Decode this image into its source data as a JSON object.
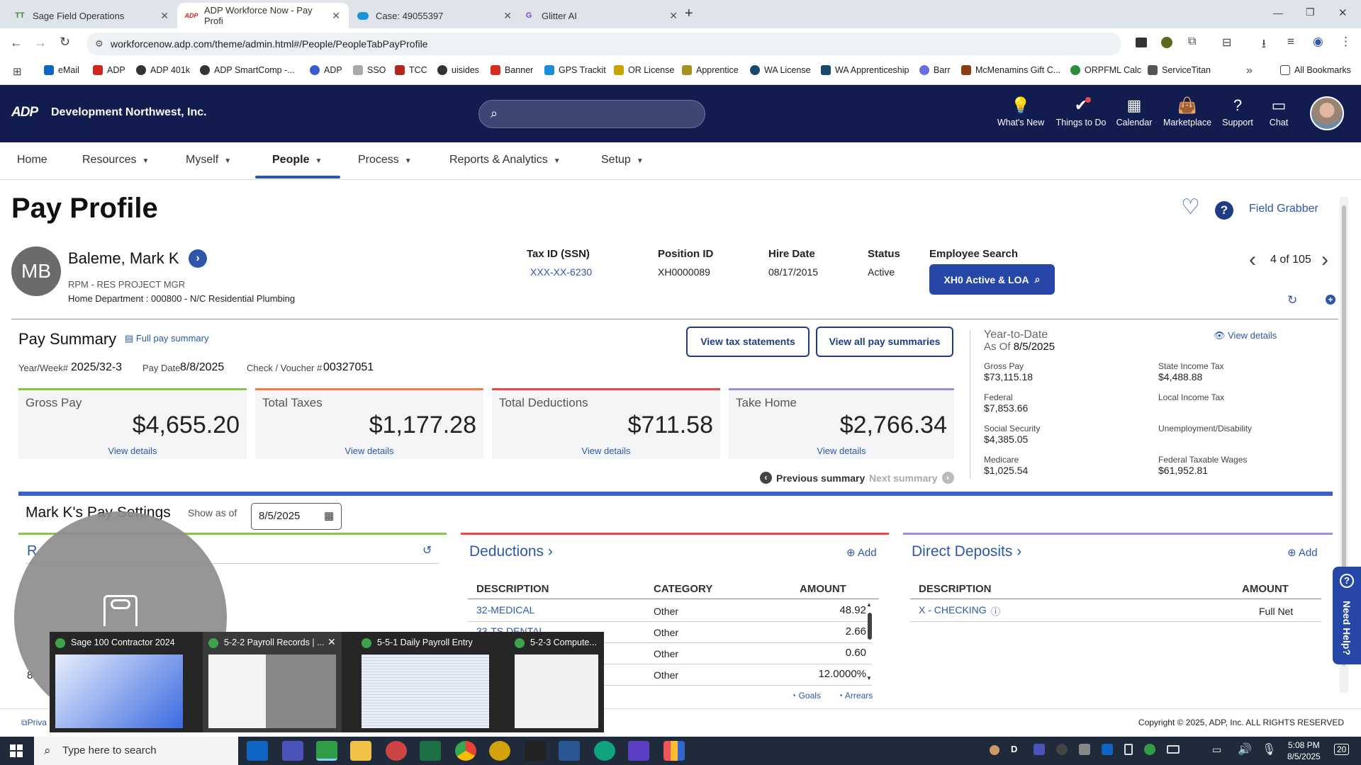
{
  "browser": {
    "tabs": [
      {
        "label": "Sage Field Operations",
        "favicon": "TT"
      },
      {
        "label": "ADP Workforce Now - Pay Profi",
        "favicon": "ADP"
      },
      {
        "label": "Case: 49055397",
        "favicon": ""
      },
      {
        "label": "Glitter AI",
        "favicon": "G"
      }
    ],
    "url": "workforcenow.adp.com/theme/admin.html#/People/PeopleTabPayProfile",
    "bookmarks": [
      "eMail",
      "ADP",
      "ADP 401k",
      "ADP SmartComp -...",
      "ADP",
      "SSO",
      "TCC",
      "uisides",
      "Banner",
      "GPS Trackit",
      "OR License",
      "Apprentice",
      "WA License",
      "WA Apprenticeship",
      "Barr",
      "McMenamins Gift C...",
      "ORPFML Calc",
      "ServiceTitan"
    ],
    "all_bookmarks": "All Bookmarks",
    "overflow": "»"
  },
  "adp": {
    "logo": "ADP",
    "company": "Development Northwest, Inc.",
    "header_nav": [
      {
        "label": "What's New",
        "icon": "lightbulb-icon",
        "glyph": "💡"
      },
      {
        "label": "Things to Do",
        "icon": "checkmark-icon",
        "glyph": "✔"
      },
      {
        "label": "Calendar",
        "icon": "calendar-icon",
        "glyph": "▦"
      },
      {
        "label": "Marketplace",
        "icon": "shopping-bag-icon",
        "glyph": "👜"
      },
      {
        "label": "Support",
        "icon": "help-icon",
        "glyph": "?"
      },
      {
        "label": "Chat",
        "icon": "chat-icon",
        "glyph": "▭"
      }
    ],
    "main_nav": [
      "Home",
      "Resources",
      "Myself",
      "People",
      "Process",
      "Reports & Analytics",
      "Setup"
    ]
  },
  "page": {
    "title": "Pay Profile",
    "field_grabber": "Field Grabber",
    "employee": {
      "initials": "MB",
      "name": "Baleme, Mark K",
      "position": "RPM - RES PROJECT MGR",
      "department": "Home Department : 000800 - N/C Residential Plumbing"
    },
    "fields": {
      "tax_id_label": "Tax ID (SSN)",
      "tax_id": "XXX-XX-6230",
      "position_id_label": "Position ID",
      "position_id": "XH0000089",
      "hire_date_label": "Hire Date",
      "hire_date": "08/17/2015",
      "status_label": "Status",
      "status": "Active",
      "employee_search_label": "Employee Search",
      "employee_search_button": "XH0 Active & LOA"
    },
    "pager": "4 of 105"
  },
  "pay_summary": {
    "title": "Pay Summary",
    "full_link": "Full pay summary",
    "view_tax": "View tax statements",
    "view_all": "View all pay summaries",
    "year_week_label": "Year/Week#",
    "year_week": "2025/32-3",
    "pay_date_label": "Pay Date",
    "pay_date": "8/8/2025",
    "voucher_label": "Check / Voucher #",
    "voucher": "00327051",
    "cards": [
      {
        "title": "Gross Pay",
        "value": "$4,655.20",
        "link": "View details",
        "color": "#8bc34a"
      },
      {
        "title": "Total Taxes",
        "value": "$1,177.28",
        "link": "View details",
        "color": "#ef7b45"
      },
      {
        "title": "Total Deductions",
        "value": "$711.58",
        "link": "View details",
        "color": "#e5484d"
      },
      {
        "title": "Take Home",
        "value": "$2,766.34",
        "link": "View details",
        "color": "#a48ad8"
      }
    ],
    "previous": "Previous summary",
    "next": "Next summary"
  },
  "ytd": {
    "title": "Year-to-Date",
    "as_of_label": "As Of",
    "as_of": "8/5/2025",
    "view_details": "View details",
    "items": [
      {
        "label": "Gross Pay",
        "value": "$73,115.18"
      },
      {
        "label": "State Income Tax",
        "value": "$4,488.88"
      },
      {
        "label": "Federal",
        "value": "$7,853.66"
      },
      {
        "label": "Local Income Tax",
        "value": ""
      },
      {
        "label": "Social Security",
        "value": "$4,385.05"
      },
      {
        "label": "Unemployment/Disability",
        "value": ""
      },
      {
        "label": "Medicare",
        "value": "$1,025.54"
      },
      {
        "label": "Federal Taxable Wages",
        "value": "$61,952.81"
      }
    ]
  },
  "settings": {
    "title": "Mark K's Pay Settings",
    "show_as_of": "Show as of",
    "date": "8/5/2025",
    "rate_title_fragment": "R",
    "rate_value_fragment": "8",
    "deductions": {
      "title": "Deductions",
      "add": "Add",
      "headers": [
        "DESCRIPTION",
        "CATEGORY",
        "AMOUNT"
      ],
      "rows": [
        {
          "desc": "32-MEDICAL",
          "cat": "Other",
          "amt": "48.92"
        },
        {
          "desc": "33-TS DENTAL",
          "cat": "Other",
          "amt": "2.66"
        },
        {
          "desc": "",
          "cat": "Other",
          "amt": "0.60"
        },
        {
          "desc": "",
          "cat": "Other",
          "amt": "12.0000%"
        }
      ],
      "goals": "Goals",
      "arrears": "Arrears"
    },
    "deposits": {
      "title": "Direct Deposits",
      "add": "Add",
      "headers": [
        "DESCRIPTION",
        "AMOUNT"
      ],
      "rows": [
        {
          "desc": "X - CHECKING",
          "amt": "Full Net"
        }
      ]
    }
  },
  "need_help": "Need Help?",
  "footer": {
    "privacy": "Priva",
    "copyright": "Copyright © 2025, ADP, Inc. ALL RIGHTS RESERVED"
  },
  "taskbar": {
    "search": "Type here to search",
    "time": "5:08 PM",
    "date": "8/5/2025",
    "notifications": "20",
    "tray_letter": "D"
  },
  "thumbnails": [
    {
      "title": "Sage 100 Contractor 2024"
    },
    {
      "title": "5-2-2 Payroll Records | ..."
    },
    {
      "title": "5-5-1 Daily Payroll Entry"
    },
    {
      "title": "5-2-3 Compute..."
    }
  ]
}
